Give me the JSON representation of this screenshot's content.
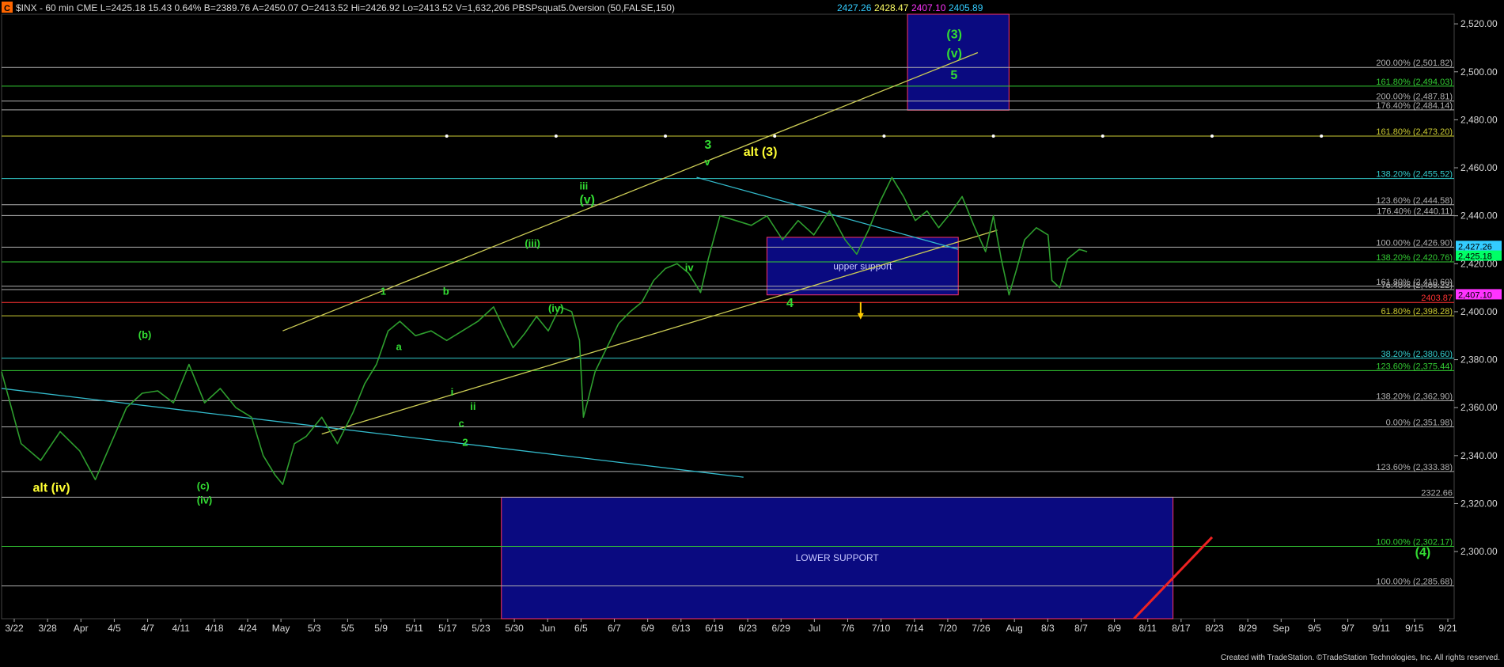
{
  "header": {
    "icon_letter": "C",
    "text": "$INX - 60 min  CME  L=2425.18  15.43  0.64%  B=2389.76  A=2450.07  O=2413.52  Hi=2426.92  Lo=2413.52  V=1,632,206  PBSPsquat5.0version (50,FALSE,150)",
    "indicator_values": [
      {
        "text": "2427.26",
        "color": "#33ccff"
      },
      {
        "text": "2428.47",
        "color": "#ffff66"
      },
      {
        "text": "2407.10",
        "color": "#ff33ff"
      },
      {
        "text": "2405.89",
        "color": "#33ccff"
      }
    ]
  },
  "footer": {
    "credit": "Created with TradeStation. ©TradeStation Technologies, Inc. All rights reserved."
  },
  "chart_data": {
    "type": "line",
    "symbol": "$INX",
    "interval": "60 min",
    "ylim": [
      2272,
      2524
    ],
    "y_ticks": [
      2300,
      2320,
      2340,
      2360,
      2380,
      2400,
      2420,
      2440,
      2460,
      2480,
      2500,
      2520
    ],
    "y_tick_labels": [
      "2,300.00",
      "2,320.00",
      "2,340.00",
      "2,360.00",
      "2,380.00",
      "2,400.00",
      "2,420.00",
      "2,440.00",
      "2,460.00",
      "2,480.00",
      "2,500.00",
      "2,520.00"
    ],
    "x_labels": [
      "3/22",
      "3/28",
      "Apr",
      "4/5",
      "4/7",
      "4/11",
      "4/18",
      "4/24",
      "May",
      "5/3",
      "5/5",
      "5/9",
      "5/11",
      "5/17",
      "5/23",
      "5/30",
      "Jun",
      "6/5",
      "6/7",
      "6/9",
      "6/13",
      "6/19",
      "6/23",
      "6/29",
      "Jul",
      "7/6",
      "7/10",
      "7/14",
      "7/20",
      "7/26",
      "Aug",
      "8/3",
      "8/7",
      "8/9",
      "8/11",
      "8/17",
      "8/23",
      "8/29",
      "Sep",
      "9/5",
      "9/7",
      "9/11",
      "9/15",
      "9/21"
    ],
    "price_path": [
      [
        0,
        2375
      ],
      [
        5,
        2345
      ],
      [
        10,
        2338
      ],
      [
        15,
        2350
      ],
      [
        20,
        2342
      ],
      [
        24,
        2330
      ],
      [
        28,
        2345
      ],
      [
        32,
        2360
      ],
      [
        36,
        2366
      ],
      [
        40,
        2367
      ],
      [
        44,
        2362
      ],
      [
        48,
        2378
      ],
      [
        52,
        2362
      ],
      [
        56,
        2368
      ],
      [
        60,
        2360
      ],
      [
        64,
        2356
      ],
      [
        67,
        2340
      ],
      [
        70,
        2332
      ],
      [
        72,
        2328
      ],
      [
        75,
        2345
      ],
      [
        78,
        2348
      ],
      [
        82,
        2356
      ],
      [
        86,
        2345
      ],
      [
        90,
        2358
      ],
      [
        93,
        2370
      ],
      [
        96,
        2378
      ],
      [
        99,
        2392
      ],
      [
        102,
        2396
      ],
      [
        106,
        2390
      ],
      [
        110,
        2392
      ],
      [
        114,
        2388
      ],
      [
        118,
        2392
      ],
      [
        122,
        2396
      ],
      [
        126,
        2402
      ],
      [
        128,
        2395
      ],
      [
        131,
        2385
      ],
      [
        134,
        2391
      ],
      [
        137,
        2398
      ],
      [
        140,
        2392
      ],
      [
        143,
        2402
      ],
      [
        146,
        2400
      ],
      [
        148,
        2388
      ],
      [
        149,
        2356
      ],
      [
        150,
        2362
      ],
      [
        152,
        2375
      ],
      [
        155,
        2385
      ],
      [
        158,
        2395
      ],
      [
        161,
        2400
      ],
      [
        164,
        2404
      ],
      [
        167,
        2413
      ],
      [
        170,
        2418
      ],
      [
        173,
        2420
      ],
      [
        176,
        2416
      ],
      [
        179,
        2408
      ],
      [
        181,
        2422
      ],
      [
        184,
        2440
      ],
      [
        188,
        2438
      ],
      [
        192,
        2436
      ],
      [
        196,
        2440
      ],
      [
        200,
        2430
      ],
      [
        204,
        2438
      ],
      [
        208,
        2432
      ],
      [
        212,
        2442
      ],
      [
        216,
        2430
      ],
      [
        219,
        2424
      ],
      [
        222,
        2434
      ],
      [
        225,
        2446
      ],
      [
        228,
        2456
      ],
      [
        231,
        2448
      ],
      [
        234,
        2438
      ],
      [
        237,
        2442
      ],
      [
        240,
        2435
      ],
      [
        243,
        2441
      ],
      [
        246,
        2448
      ],
      [
        249,
        2436
      ],
      [
        252,
        2425
      ],
      [
        254,
        2440
      ],
      [
        256,
        2422
      ],
      [
        258,
        2407
      ],
      [
        260,
        2418
      ],
      [
        262,
        2430
      ],
      [
        265,
        2435
      ],
      [
        268,
        2432
      ],
      [
        269,
        2413
      ],
      [
        271,
        2410
      ],
      [
        273,
        2422
      ],
      [
        276,
        2426
      ],
      [
        278,
        2425
      ]
    ],
    "fib_levels": [
      {
        "value": 2501.82,
        "label": "200.00% (2,501.82)",
        "color": "#b0b0b0"
      },
      {
        "value": 2494.03,
        "label": "161.80% (2,494.03)",
        "color": "#33cc33"
      },
      {
        "value": 2487.81,
        "label": "200.00% (2,487.81)",
        "color": "#b0b0b0"
      },
      {
        "value": 2484.14,
        "label": "176.40% (2,484.14)",
        "color": "#b0b0b0"
      },
      {
        "value": 2473.2,
        "label": "161.80% (2,473.20)",
        "color": "#cccc33"
      },
      {
        "value": 2455.52,
        "label": "138.20% (2,455.52)",
        "color": "#33cccc"
      },
      {
        "value": 2444.58,
        "label": "123.60% (2,444.58)",
        "color": "#b0b0b0"
      },
      {
        "value": 2440.11,
        "label": "176.40% (2,440.11)",
        "color": "#b0b0b0"
      },
      {
        "value": 2426.9,
        "label": "100.00% (2,426.90)",
        "color": "#b0b0b0"
      },
      {
        "value": 2420.76,
        "label": "138.20% (2,420.76)",
        "color": "#33cc33"
      },
      {
        "value": 2410.6,
        "label": "161.80% (2,410.60)",
        "color": "#b0b0b0"
      },
      {
        "value": 2409.22,
        "label": "76.40% (2,409.22)",
        "color": "#b0b0b0"
      },
      {
        "value": 2403.87,
        "label": "2403.87",
        "color": "#ff3333"
      },
      {
        "value": 2398.28,
        "label": "61.80% (2,398.28)",
        "color": "#cccc33"
      },
      {
        "value": 2380.6,
        "label": "38.20% (2,380.60)",
        "color": "#33cccc"
      },
      {
        "value": 2375.44,
        "label": "123.60% (2,375.44)",
        "color": "#33cc33"
      },
      {
        "value": 2362.9,
        "label": "138.20% (2,362.90)",
        "color": "#b0b0b0"
      },
      {
        "value": 2351.98,
        "label": "0.00% (2,351.98)",
        "color": "#b0b0b0"
      },
      {
        "value": 2333.38,
        "label": "123.60% (2,333.38)",
        "color": "#b0b0b0"
      },
      {
        "value": 2322.66,
        "label": "2322.66",
        "color": "#b0b0b0"
      },
      {
        "value": 2302.17,
        "label": "100.00% (2,302.17)",
        "color": "#33cc33"
      },
      {
        "value": 2285.68,
        "label": "100.00% (2,285.68)",
        "color": "#b0b0b0"
      }
    ],
    "zones": [
      {
        "label": "",
        "x": [
          232,
          258
        ],
        "y": [
          2484,
          2524
        ],
        "fill": "#0a0a80",
        "border": "#ff3366"
      },
      {
        "label": "upper support",
        "x": [
          196,
          245
        ],
        "y": [
          2407,
          2431
        ],
        "fill": "#0a0a80",
        "border": "#ff3366"
      },
      {
        "label": "LOWER SUPPORT",
        "x": [
          128,
          300
        ],
        "y": [
          2272,
          2322.66
        ],
        "fill": "#0a0a80",
        "border": "#ff3366"
      }
    ],
    "trendlines": [
      {
        "color": "#cccc55",
        "points": [
          [
            82,
            2349
          ],
          [
            255,
            2434
          ]
        ]
      },
      {
        "color": "#cccc55",
        "points": [
          [
            72,
            2392
          ],
          [
            250,
            2508
          ]
        ]
      },
      {
        "color": "#33bbcc",
        "points": [
          [
            0,
            2368
          ],
          [
            190,
            2331
          ]
        ]
      },
      {
        "color": "#33bbcc",
        "points": [
          [
            178,
            2456
          ],
          [
            245,
            2426
          ]
        ]
      },
      {
        "color": "#ee2222",
        "points": [
          [
            290,
            2272
          ],
          [
            310,
            2306
          ]
        ]
      }
    ],
    "wave_labels": [
      {
        "text": "alt (iv)",
        "x": 8,
        "y": 2325,
        "color": "#ffff33"
      },
      {
        "text": "(b)",
        "x": 35,
        "y": 2389,
        "color": "#33dd33"
      },
      {
        "text": "(c)",
        "x": 50,
        "y": 2326,
        "color": "#33dd33"
      },
      {
        "text": "(iv)",
        "x": 50,
        "y": 2320,
        "color": "#33dd33"
      },
      {
        "text": "1",
        "x": 97,
        "y": 2407,
        "color": "#33dd33"
      },
      {
        "text": "a",
        "x": 101,
        "y": 2384,
        "color": "#33dd33"
      },
      {
        "text": "b",
        "x": 113,
        "y": 2407,
        "color": "#33dd33"
      },
      {
        "text": "i",
        "x": 115,
        "y": 2365,
        "color": "#33dd33"
      },
      {
        "text": "c",
        "x": 117,
        "y": 2352,
        "color": "#33dd33"
      },
      {
        "text": "ii",
        "x": 120,
        "y": 2359,
        "color": "#33dd33"
      },
      {
        "text": "2",
        "x": 118,
        "y": 2344,
        "color": "#33dd33"
      },
      {
        "text": "(iii)",
        "x": 134,
        "y": 2427,
        "color": "#33dd33"
      },
      {
        "text": "(iv)",
        "x": 140,
        "y": 2400,
        "color": "#33dd33"
      },
      {
        "text": "iii",
        "x": 148,
        "y": 2451,
        "color": "#33dd33"
      },
      {
        "text": "(v)",
        "x": 148,
        "y": 2445,
        "color": "#33dd33"
      },
      {
        "text": "iv",
        "x": 175,
        "y": 2417,
        "color": "#33dd33"
      },
      {
        "text": "3",
        "x": 180,
        "y": 2468,
        "color": "#33dd33"
      },
      {
        "text": "v",
        "x": 180,
        "y": 2461,
        "color": "#33dd33"
      },
      {
        "text": "alt  (3)",
        "x": 190,
        "y": 2465,
        "color": "#ffff33"
      },
      {
        "text": "4",
        "x": 201,
        "y": 2402,
        "color": "#33dd33"
      },
      {
        "text": "(3)",
        "x": 242,
        "y": 2514,
        "color": "#33dd33"
      },
      {
        "text": "(v)",
        "x": 242,
        "y": 2506,
        "color": "#33dd33"
      },
      {
        "text": "5",
        "x": 243,
        "y": 2497,
        "color": "#33dd33"
      },
      {
        "text": "(4)",
        "x": 362,
        "y": 2298,
        "color": "#33dd33"
      }
    ],
    "price_markers": [
      {
        "value": 2427.26,
        "text": "2,427.26",
        "color": "#33ccff"
      },
      {
        "value": 2425.18,
        "text": "2,425.18",
        "color": "#00ff66"
      },
      {
        "value": 2407.1,
        "text": "2,407.10",
        "color": "#ff33ff"
      }
    ]
  }
}
